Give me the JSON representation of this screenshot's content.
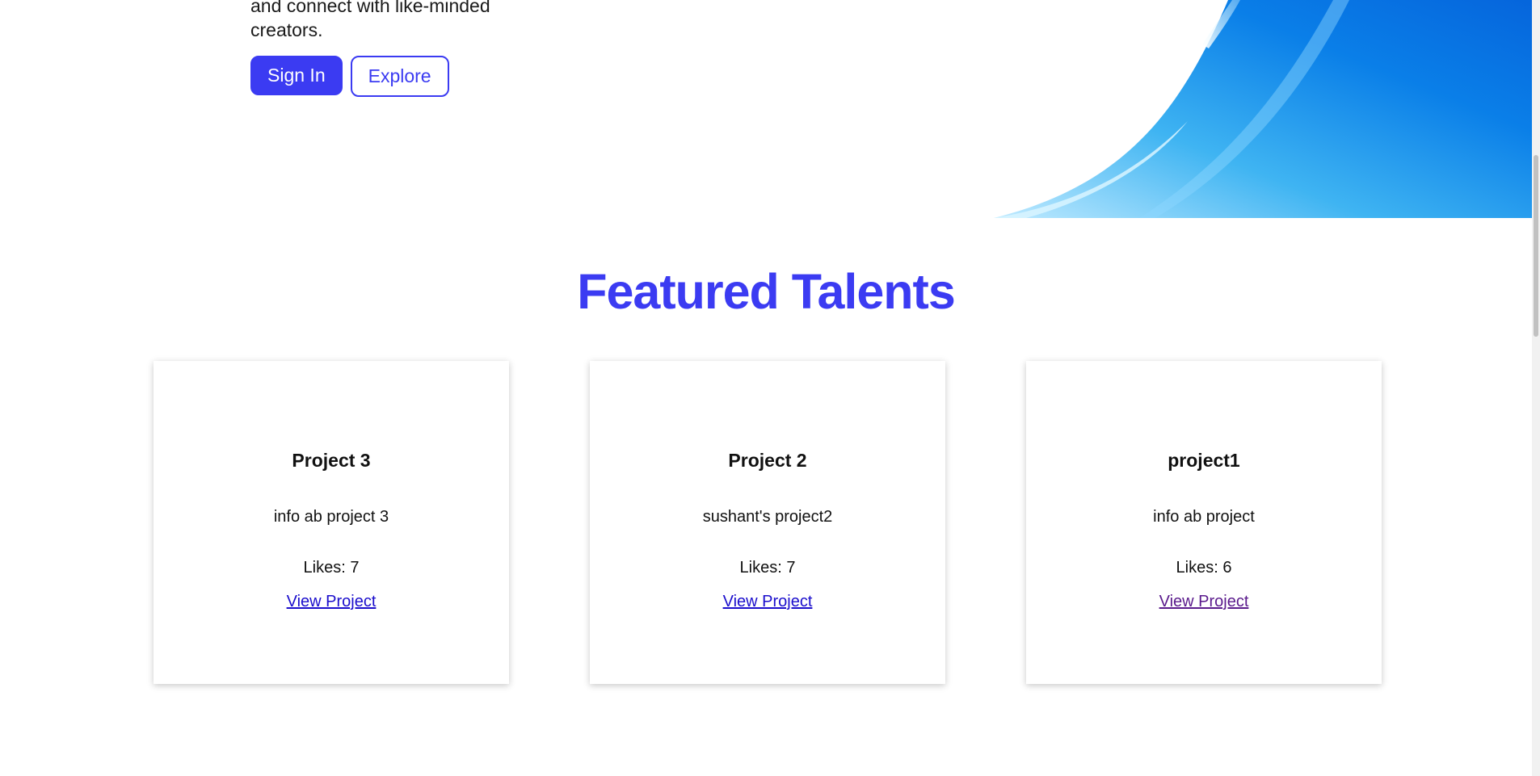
{
  "hero": {
    "text_line1": "and connect with like-minded",
    "text_line2": "creators.",
    "signin_label": "Sign In",
    "explore_label": "Explore"
  },
  "featured": {
    "title": "Featured Talents",
    "cards": [
      {
        "title": "Project 3",
        "description": "info ab project 3",
        "likes": "Likes: 7",
        "link": "View Project"
      },
      {
        "title": "Project 2",
        "description": "sushant's project2",
        "likes": "Likes: 7",
        "link": "View Project"
      },
      {
        "title": "project1",
        "description": "info ab project",
        "likes": "Likes: 6",
        "link": "View Project"
      }
    ]
  },
  "colors": {
    "accent": "#3b3bf2",
    "link": "#1a0dcc",
    "link_visited": "#5a1a8c",
    "wave_light": "#9fe0ff",
    "wave_dark": "#0a6fe0"
  }
}
